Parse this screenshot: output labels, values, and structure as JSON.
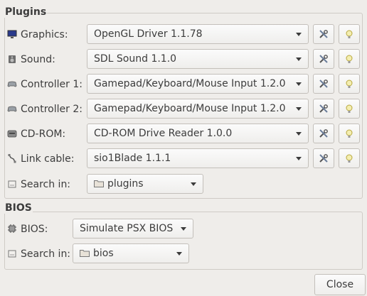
{
  "plugins": {
    "title": "Plugins",
    "rows": [
      {
        "label": "Graphics:",
        "icon": "monitor-icon",
        "value": "OpenGL Driver 1.1.78"
      },
      {
        "label": "Sound:",
        "icon": "speaker-icon",
        "value": "SDL Sound 1.1.0"
      },
      {
        "label": "Controller 1:",
        "icon": "gamepad-icon",
        "value": "Gamepad/Keyboard/Mouse Input 1.2.0"
      },
      {
        "label": "Controller 2:",
        "icon": "gamepad-icon",
        "value": "Gamepad/Keyboard/Mouse Input 1.2.0"
      },
      {
        "label": "CD-ROM:",
        "icon": "disc-drive-icon",
        "value": "CD-ROM Drive Reader 1.0.0"
      },
      {
        "label": "Link cable:",
        "icon": "cable-icon",
        "value": "sio1Blade 1.1.1"
      }
    ],
    "search_label": "Search in:",
    "search_value": "plugins"
  },
  "bios": {
    "title": "BIOS",
    "label": "BIOS:",
    "value": "Simulate PSX BIOS",
    "search_label": "Search in:",
    "search_value": "bios"
  },
  "close_label": "Close"
}
